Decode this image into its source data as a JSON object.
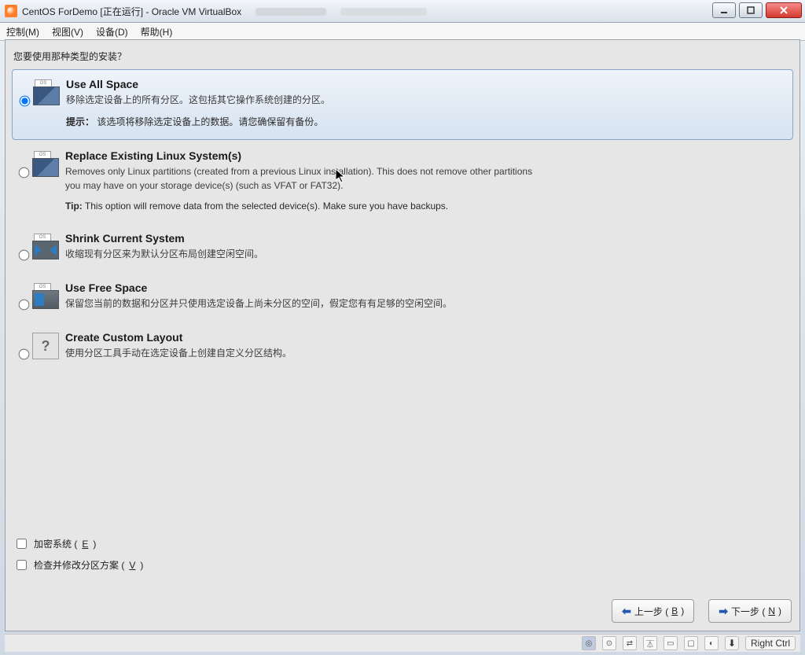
{
  "window": {
    "title": "CentOS ForDemo [正在运行] - Oracle VM VirtualBox"
  },
  "menubar": {
    "control": "控制(M)",
    "view": "视图(V)",
    "devices": "设备(D)",
    "help": "帮助(H)"
  },
  "installer": {
    "heading": "您要使用那种类型的安装？",
    "options": [
      {
        "id": "use-all-space",
        "title": "Use All Space",
        "desc": "移除选定设备上的所有分区。这包括其它操作系统创建的分区。",
        "tip_label": "提示：",
        "tip": "该选项将移除选定设备上的数据。请您确保留有备份。",
        "selected": true
      },
      {
        "id": "replace-linux",
        "title": "Replace Existing Linux System(s)",
        "desc": "Removes only Linux partitions (created from a previous Linux installation).  This does not remove other partitions you may have on your storage device(s) (such as VFAT or FAT32).",
        "tip_label": "Tip:",
        "tip": "This option will remove data from the selected device(s).  Make sure you have backups.",
        "selected": false
      },
      {
        "id": "shrink",
        "title": "Shrink Current System",
        "desc": "收缩现有分区来为默认分区布局创建空闲空间。",
        "tip_label": "",
        "tip": "",
        "selected": false
      },
      {
        "id": "free-space",
        "title": "Use Free Space",
        "desc": "保留您当前的数据和分区并只使用选定设备上尚未分区的空间，假定您有有足够的空闲空间。",
        "tip_label": "",
        "tip": "",
        "selected": false
      },
      {
        "id": "custom",
        "title": "Create Custom Layout",
        "desc": "使用分区工具手动在选定设备上创建自定义分区结构。",
        "tip_label": "",
        "tip": "",
        "selected": false
      }
    ],
    "checkboxes": {
      "encrypt_pre": "加密系统 (",
      "encrypt_accel": "E",
      "encrypt_post": ")",
      "review_pre": "检查并修改分区方案 (",
      "review_accel": "V",
      "review_post": ")"
    },
    "nav": {
      "back_pre": "上一步 (",
      "back_accel": "B",
      "back_post": ")",
      "next_pre": "下一步 (",
      "next_accel": "N",
      "next_post": ")"
    }
  },
  "statusbar": {
    "hostkey": "Right Ctrl"
  }
}
